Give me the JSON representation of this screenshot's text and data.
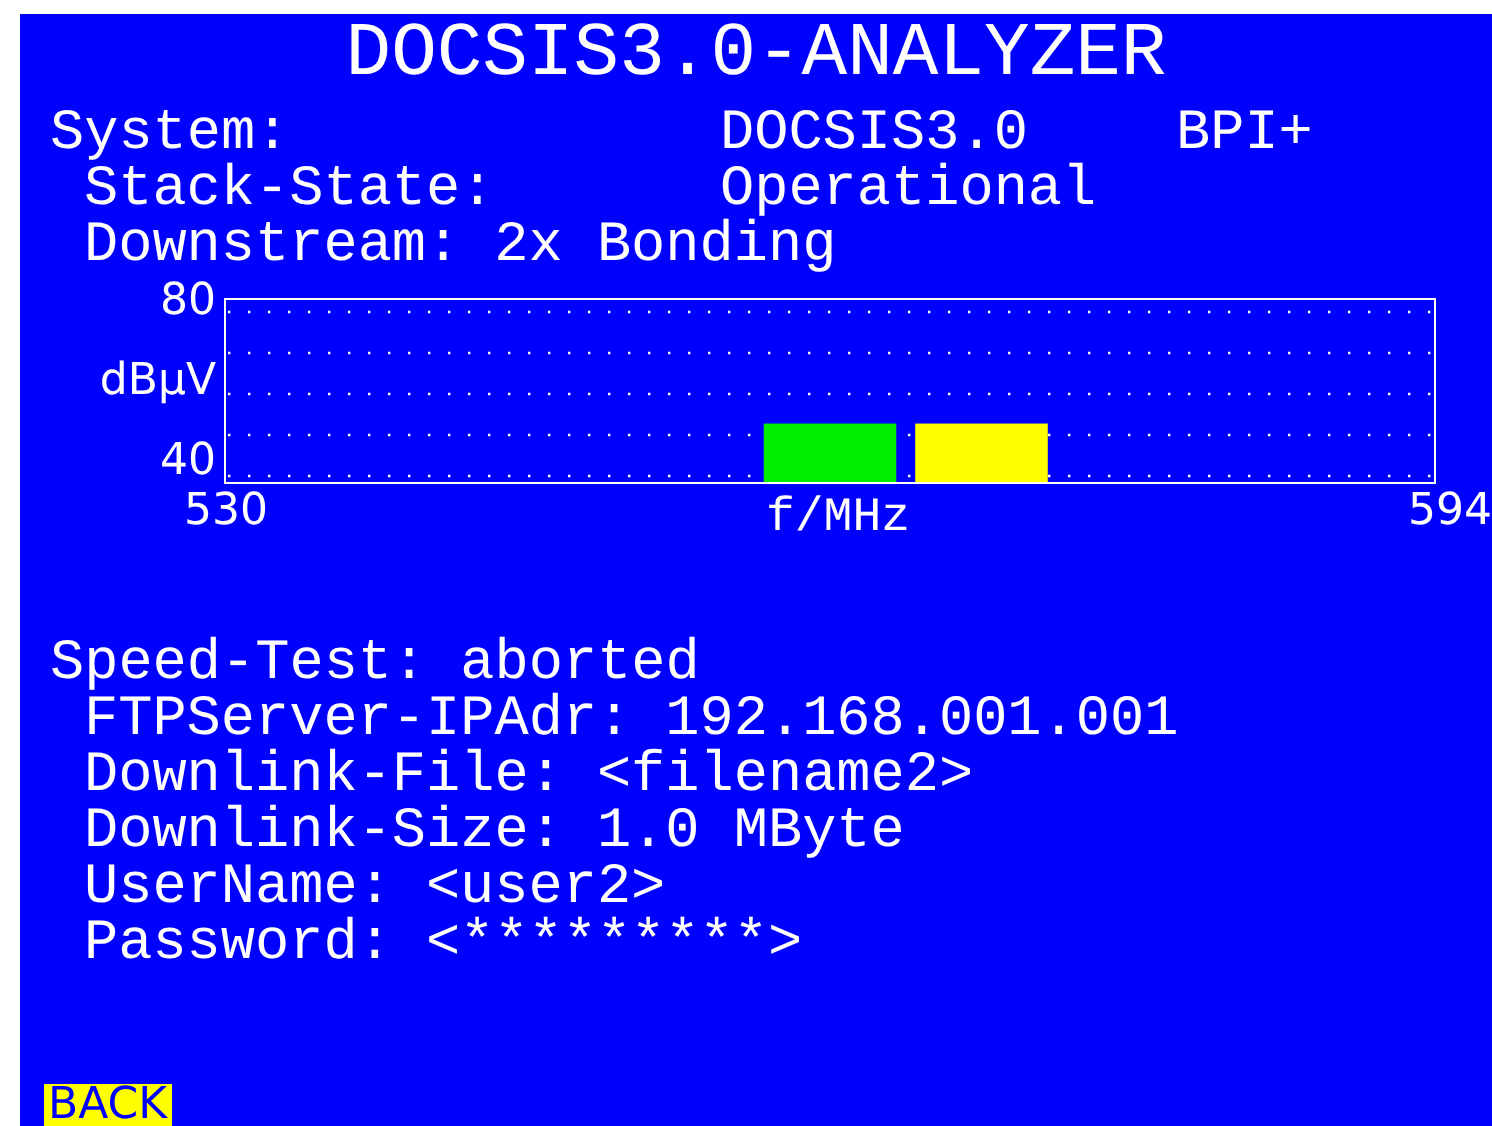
{
  "title": "DOCSIS3.0-ANALYZER",
  "system": {
    "label": "System:",
    "value": "DOCSIS3.0",
    "encryption": "BPI+"
  },
  "stack_state": {
    "label": "Stack-State:",
    "value": "Operational"
  },
  "downstream": {
    "label": "Downstream:",
    "value": "2x Bonding"
  },
  "chart": {
    "chart_data": {
      "type": "bar",
      "xlabel": "f/MHz",
      "ylabel": "dBµV",
      "x": [
        562,
        570
      ],
      "xlim": [
        530,
        594
      ],
      "ylim": [
        40,
        80
      ],
      "xticks": [
        530,
        594
      ],
      "yticks": [
        40,
        80
      ],
      "series": [
        {
          "color": "#00ee00",
          "values": [
            53,
            null
          ]
        },
        {
          "color": "#ffff00",
          "values": [
            null,
            53
          ]
        }
      ]
    }
  },
  "speed_test": {
    "label": "Speed-Test:",
    "status": "aborted",
    "fields": [
      {
        "label": "FTPServer-IPAdr:",
        "value": "192.168.001.001"
      },
      {
        "label": "Downlink-File:",
        "value": "<filename2>"
      },
      {
        "label": "Downlink-Size:",
        "value": "1.0 MByte"
      },
      {
        "label": "UserName:",
        "value": "<user2>"
      },
      {
        "label": "Password:",
        "value": "<*********>"
      }
    ]
  },
  "back_button": "BACK"
}
